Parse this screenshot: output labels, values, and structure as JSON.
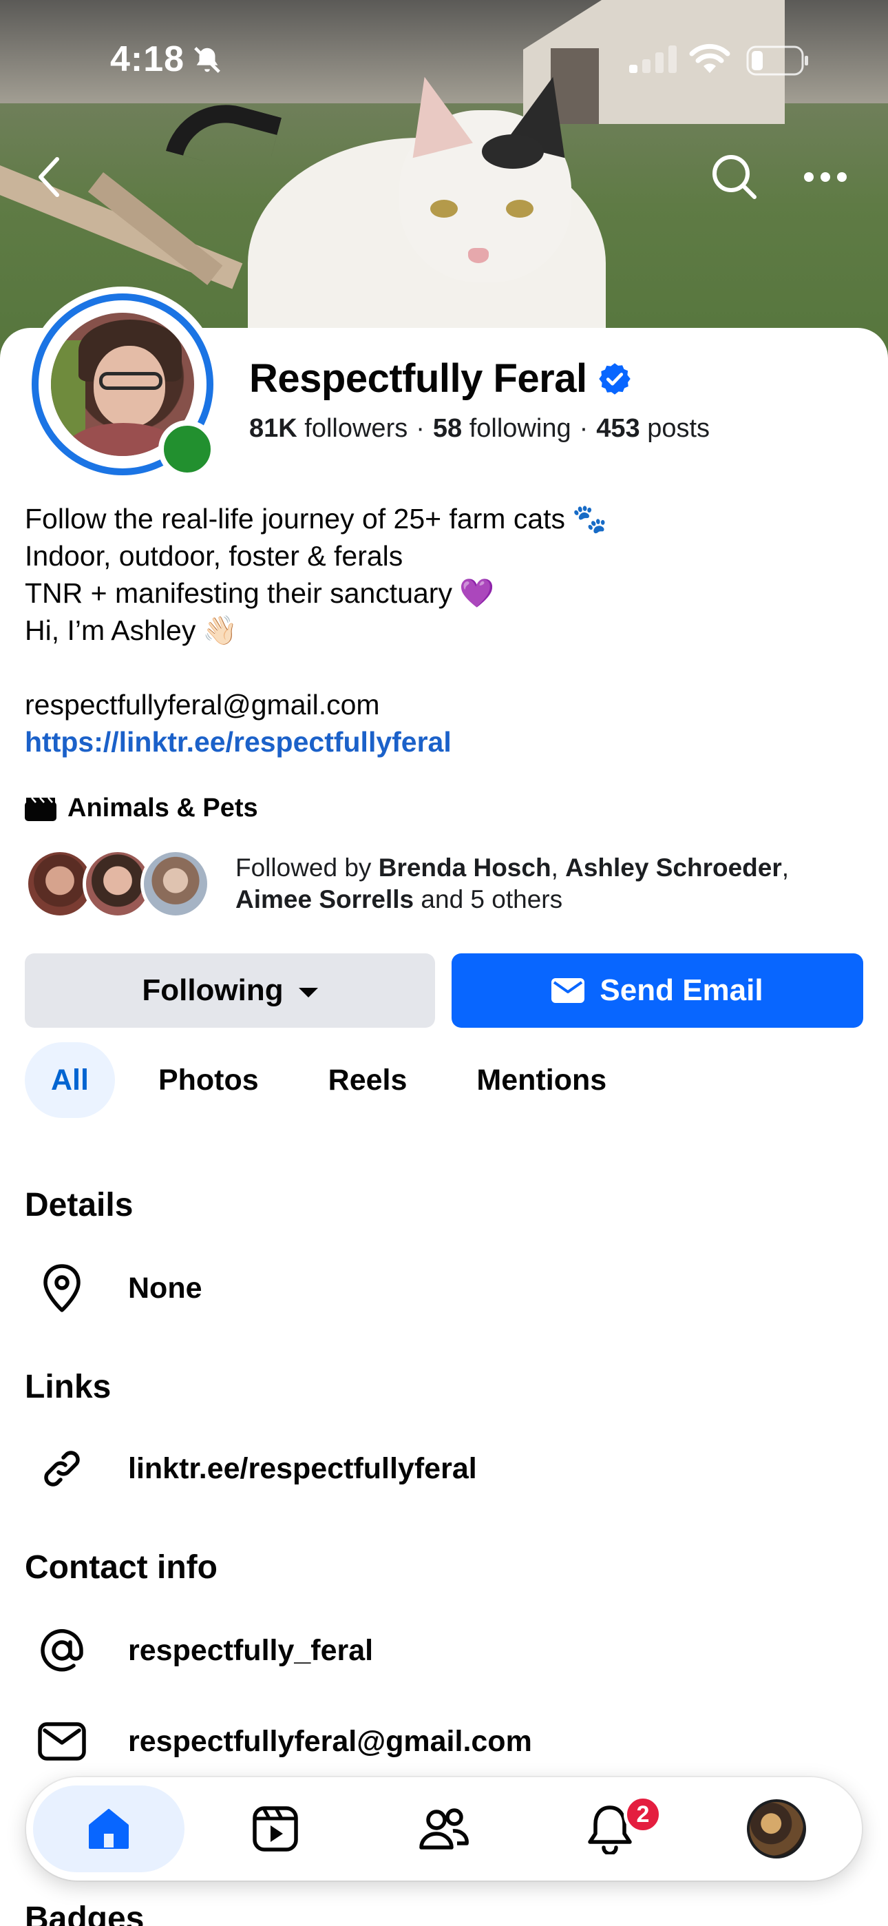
{
  "status_bar": {
    "time": "4:18"
  },
  "profile": {
    "name": "Respectfully Feral",
    "followers_count": "81K",
    "followers_label": "followers",
    "following_count": "58",
    "following_label": "following",
    "posts_count": "453",
    "posts_label": "posts",
    "separator": "·"
  },
  "bio": {
    "line1": "Follow the real-life journey of 25+ farm cats",
    "line1_emoji": "🐾",
    "line2": "Indoor, outdoor, foster & ferals",
    "line3": "TNR + manifesting their sanctuary",
    "line3_emoji": "💜",
    "line4": "Hi, I’m Ashley",
    "line4_emoji": "👋🏻",
    "email": "respectfullyferal@gmail.com",
    "link": "https://linktr.ee/respectfullyferal"
  },
  "category": "Animals & Pets",
  "followed_by": {
    "prefix": "Followed by",
    "name1": "Brenda Hosch",
    "sep1": ",",
    "name2": "Ashley Schroeder",
    "sep2": ",",
    "name3": "Aimee Sorrells",
    "suffix": "and 5 others"
  },
  "actions": {
    "following_label": "Following",
    "send_email_label": "Send Email"
  },
  "tabs": [
    {
      "label": "All",
      "active": true
    },
    {
      "label": "Photos",
      "active": false
    },
    {
      "label": "Reels",
      "active": false
    },
    {
      "label": "Mentions",
      "active": false
    }
  ],
  "details": {
    "title": "Details",
    "location": "None"
  },
  "links": {
    "title": "Links",
    "url": "linktr.ee/respectfullyferal"
  },
  "contact": {
    "title": "Contact info",
    "instagram": "respectfully_feral",
    "email": "respectfullyferal@gmail.com"
  },
  "badges_title": "Badges",
  "bottom_nav": {
    "items": [
      "home-icon",
      "video-icon",
      "friends-icon",
      "bell-icon",
      "profile-avatar"
    ],
    "notifications_count": "2"
  },
  "colors": {
    "brand_blue": "#0866ff",
    "link_blue": "#1b61c9",
    "online_green": "#22902f",
    "badge_red": "#e41e3f"
  }
}
